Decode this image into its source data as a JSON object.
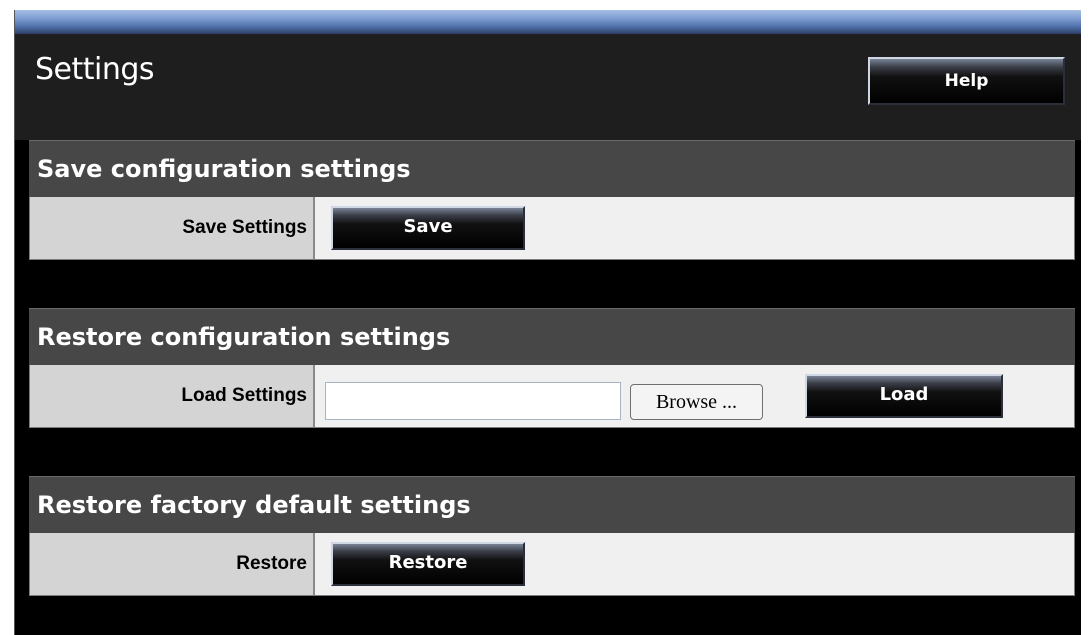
{
  "header": {
    "title": "Settings",
    "help_label": "Help"
  },
  "sections": [
    {
      "heading": "Save configuration settings",
      "row_label": "Save Settings",
      "button_label": "Save"
    },
    {
      "heading": "Restore configuration settings",
      "row_label": "Load Settings",
      "file_value": "",
      "browse_label": "Browse ...",
      "button_label": "Load"
    },
    {
      "heading": "Restore factory default settings",
      "row_label": "Restore",
      "button_label": "Restore"
    }
  ],
  "colors": {
    "background": "#000000",
    "section_header": "#474747",
    "label_cell": "#d4d4d4",
    "value_cell": "#f0f0f0",
    "accent_bar": "#7f9dd2"
  }
}
